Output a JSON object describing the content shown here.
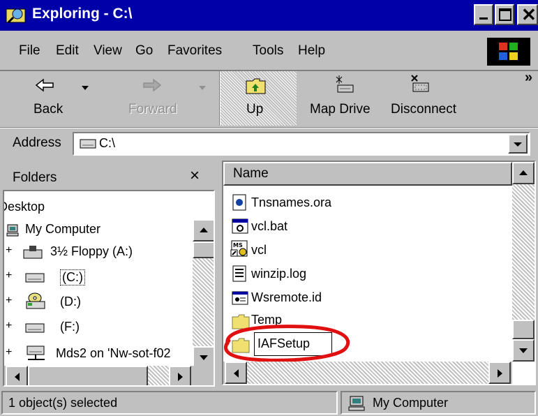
{
  "window": {
    "title": "Exploring - C:\\"
  },
  "menu": [
    "File",
    "Edit",
    "View",
    "Go",
    "Favorites",
    "Tools",
    "Help"
  ],
  "toolbar": {
    "back": "Back",
    "forward": "Forward",
    "up": "Up",
    "map_drive": "Map Drive",
    "disconnect": "Disconnect",
    "chevron": "»"
  },
  "address": {
    "label": "Address",
    "value": "C:\\"
  },
  "folders": {
    "header": "Folders",
    "close": "×",
    "items": [
      {
        "label": "Desktop"
      },
      {
        "label": "My Computer"
      },
      {
        "label": "3½ Floppy (A:)",
        "expander": "+"
      },
      {
        "label": "(C:)",
        "expander": "+"
      },
      {
        "label": "(D:)",
        "expander": "+"
      },
      {
        "label": "(F:)",
        "expander": "+"
      },
      {
        "label": "Mds2 on 'Nw-sot-f02",
        "expander": "+"
      }
    ]
  },
  "files": {
    "column_name": "Name",
    "items": [
      {
        "name": "Tnsnames.ora"
      },
      {
        "name": "vcl.bat"
      },
      {
        "name": "vcl"
      },
      {
        "name": "winzip.log"
      },
      {
        "name": "Wsremote.id"
      },
      {
        "name": "Temp"
      },
      {
        "name": "IAFSetup"
      }
    ]
  },
  "status": {
    "left": "1 object(s) selected",
    "right": "My Computer"
  }
}
